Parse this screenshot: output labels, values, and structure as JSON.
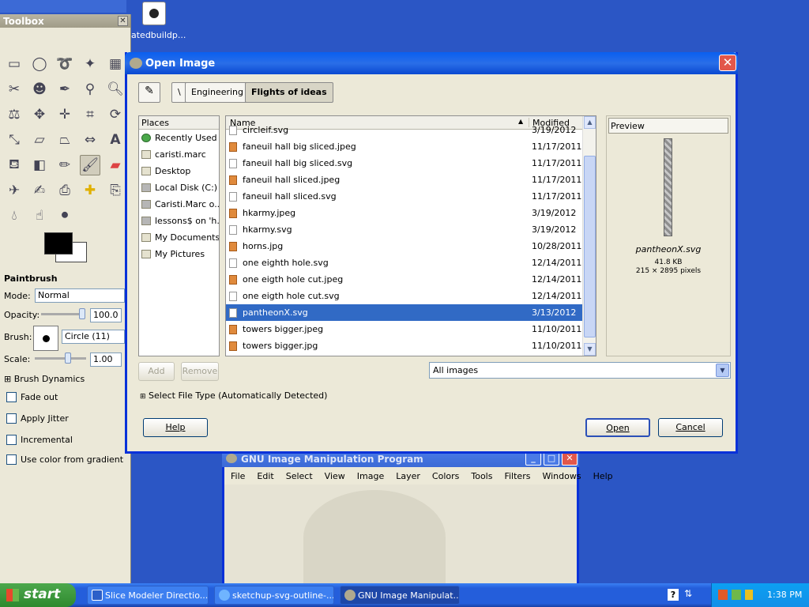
{
  "desktop": {
    "icon_label": "atedbuildp..."
  },
  "toolbox": {
    "title": "Toolbox",
    "close": "✕",
    "options_title": "Paintbrush",
    "mode_label": "Mode:",
    "mode_value": "Normal",
    "opacity_label": "Opacity:",
    "opacity_value": "100.0",
    "brush_label": "Brush:",
    "brush_value": "Circle (11)",
    "scale_label": "Scale:",
    "scale_value": "1.00",
    "brush_dynamics": "Brush Dynamics",
    "expander": "⊞",
    "checks": [
      "Fade out",
      "Apply Jitter",
      "Incremental",
      "Use color from gradient"
    ]
  },
  "dialog": {
    "title": "Open Image",
    "close": "✕",
    "path_edit_icon": "✎",
    "path": [
      "\\",
      "Engineering",
      "Flights of ideas"
    ],
    "places_header": "Places",
    "places": [
      {
        "label": "Recently Used",
        "icon": "recent"
      },
      {
        "label": "caristi.marc",
        "icon": "folder"
      },
      {
        "label": "Desktop",
        "icon": "folder"
      },
      {
        "label": "Local Disk (C:)",
        "icon": "disk"
      },
      {
        "label": "Caristi.Marc o...",
        "icon": "disk"
      },
      {
        "label": "lessons$ on 'h...",
        "icon": "disk"
      },
      {
        "label": "My Documents",
        "icon": "folder"
      },
      {
        "label": "My Pictures",
        "icon": "folder"
      }
    ],
    "col_name": "Name",
    "col_modified": "Modified",
    "sort_arrow": "▲",
    "files": [
      {
        "name": "circleif.svg",
        "date": "3/19/2012",
        "type": "svg"
      },
      {
        "name": "faneuil hall big sliced.jpeg",
        "date": "11/17/2011",
        "type": "jpg"
      },
      {
        "name": "faneuil hall big sliced.svg",
        "date": "11/17/2011",
        "type": "svg"
      },
      {
        "name": "faneuil hall sliced.jpeg",
        "date": "11/17/2011",
        "type": "jpg"
      },
      {
        "name": "faneuil hall sliced.svg",
        "date": "11/17/2011",
        "type": "svg"
      },
      {
        "name": "hkarmy.jpeg",
        "date": "3/19/2012",
        "type": "jpg"
      },
      {
        "name": "hkarmy.svg",
        "date": "3/19/2012",
        "type": "svg"
      },
      {
        "name": "horns.jpg",
        "date": "10/28/2011",
        "type": "jpg"
      },
      {
        "name": "one eighth hole.svg",
        "date": "12/14/2011",
        "type": "svg"
      },
      {
        "name": "one eigth hole cut.jpeg",
        "date": "12/14/2011",
        "type": "jpg"
      },
      {
        "name": "one eigth hole cut.svg",
        "date": "12/14/2011",
        "type": "svg"
      },
      {
        "name": "pantheonX.svg",
        "date": "3/13/2012",
        "type": "svg",
        "selected": true
      },
      {
        "name": "towers bigger.jpeg",
        "date": "11/10/2011",
        "type": "jpg"
      },
      {
        "name": "towers bigger.jpg",
        "date": "11/10/2011",
        "type": "jpg"
      }
    ],
    "preview_label": "Preview",
    "preview_name": "pantheonX.svg",
    "preview_size": "41.8 KB",
    "preview_dims": "215 × 2895 pixels",
    "add_label": "Add",
    "remove_label": "Remove",
    "filter_value": "All images",
    "select_type": "Select File Type (Automatically Detected)",
    "help_label": "Help",
    "open_label": "Open",
    "cancel_label": "Cancel"
  },
  "gimp_window": {
    "title": "GNU Image Manipulation Program",
    "menu": [
      "File",
      "Edit",
      "Select",
      "View",
      "Image",
      "Layer",
      "Colors",
      "Tools",
      "Filters",
      "Windows",
      "Help"
    ]
  },
  "taskbar": {
    "start": "start",
    "tasks": [
      "Slice Modeler Directio...",
      "sketchup-svg-outline-...",
      "GNU Image Manipulat..."
    ],
    "clock": "1:38 PM"
  }
}
